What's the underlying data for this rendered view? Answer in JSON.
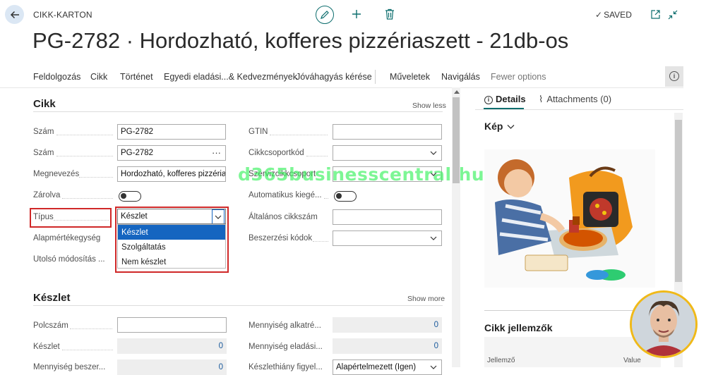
{
  "header": {
    "kicker": "CIKK-KARTON",
    "status": "SAVED",
    "title": "PG-2782 · Hordozható, kofferes pizzériaszett - 21db-os"
  },
  "actions": [
    "Feldolgozás",
    "Cikk",
    "Történet",
    "Egyedi eladási...& Kedvezmények",
    "Jóváhagyás kérése",
    "Műveletek",
    "Navigálás",
    "Fewer options"
  ],
  "cikk": {
    "title": "Cikk",
    "show_link": "Show less",
    "left": [
      {
        "label": "Szám",
        "value": "PG-2782"
      },
      {
        "label": "Szám",
        "value": "PG-2782"
      },
      {
        "label": "Megnevezés",
        "value": "Hordozható, kofferes pizzéria"
      },
      {
        "label": "Zárolva",
        "value": ""
      },
      {
        "label": "Típus",
        "value": "Készlet"
      },
      {
        "label": "Alapmértékegység",
        "value": ""
      },
      {
        "label": "Utolsó módosítás ...",
        "value": ""
      }
    ],
    "right": [
      {
        "label": "GTIN",
        "value": ""
      },
      {
        "label": "Cikkcsoportkód",
        "value": ""
      },
      {
        "label": "Szervizcikkcsoport",
        "value": ""
      },
      {
        "label": "Automatikus kiegé...",
        "value": ""
      },
      {
        "label": "Általános cikkszám",
        "value": ""
      },
      {
        "label": "Beszerzési kódok",
        "value": ""
      }
    ],
    "tipus_options": [
      "Készlet",
      "Szolgáltatás",
      "Nem készlet"
    ],
    "tipus_selected_index": 0
  },
  "keszlet": {
    "title": "Készlet",
    "show_link": "Show more",
    "left": [
      {
        "label": "Polcszám",
        "value": ""
      },
      {
        "label": "Készlet",
        "value": "0"
      },
      {
        "label": "Mennyiség beszer...",
        "value": "0"
      }
    ],
    "right": [
      {
        "label": "Mennyiség alkatré...",
        "value": "0"
      },
      {
        "label": "Mennyiség eladási...",
        "value": "0"
      },
      {
        "label": "Készlethiány figyel...",
        "value": "Alapértelmezett (Igen)"
      }
    ]
  },
  "watermark": "d365businesscentral.hu",
  "panel": {
    "tab_details": "Details",
    "tab_attachments": "Attachments (0)",
    "picture_title": "Kép",
    "attributes_title": "Cikk jellemzők",
    "col_attribute": "Jellemző",
    "col_value": "Value"
  },
  "colors": {
    "accent": "#0f6e6e",
    "selection": "#1565c0",
    "highlight": "#d02828",
    "watermark": "#39f25d"
  }
}
